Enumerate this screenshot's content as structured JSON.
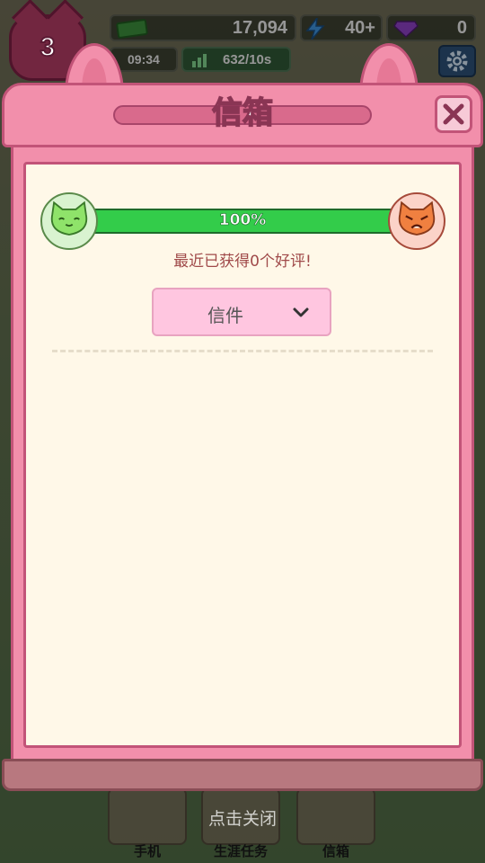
{
  "hud": {
    "level": "3",
    "money": "17,094",
    "energy": "40+",
    "gems": "0",
    "time": "09:34",
    "income_rate": "632/10s"
  },
  "modal": {
    "title": "信箱",
    "progress_percent": 100,
    "progress_label": "100%",
    "status_text": "最近已获得0个好评!",
    "dropdown_label": "信件"
  },
  "bottom_nav": {
    "items": [
      {
        "label": "手机"
      },
      {
        "label": "生涯任务"
      },
      {
        "label": "信箱"
      }
    ]
  },
  "footer_hint": "点击关闭",
  "icons": {
    "money": "cash-icon",
    "energy": "lightning-icon",
    "gems": "gem-icon",
    "time": "sun-icon",
    "rate": "income-chart-icon",
    "settings": "gear-icon",
    "close": "close-icon",
    "happy": "happy-cat-icon",
    "angry": "angry-cat-icon",
    "dropdown": "chevron-down-icon"
  },
  "colors": {
    "modal_pink": "#f28fab",
    "progress_green": "#33cc4a",
    "inner_cream": "#fff8e8"
  }
}
